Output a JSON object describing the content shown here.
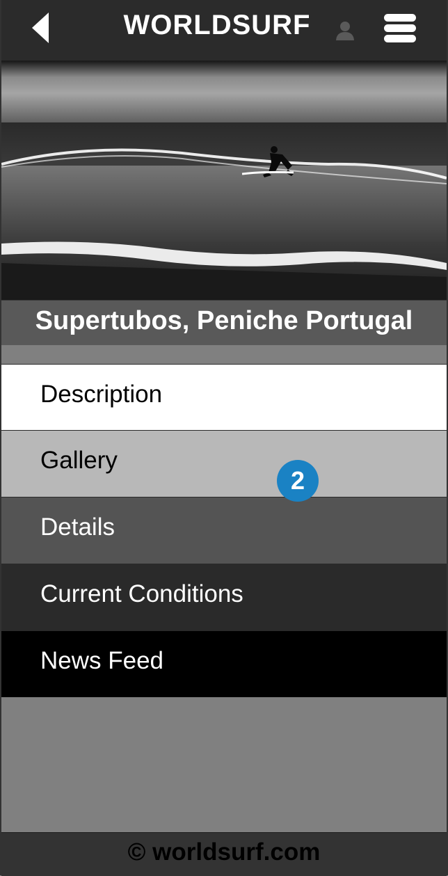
{
  "header": {
    "title": "WORLDSURF",
    "icons": {
      "back": "chevron-left-icon",
      "profile": "user-icon",
      "menu": "hamburger-menu-icon"
    }
  },
  "hero": {
    "image": "black-and-white photo of a surfer riding a wave"
  },
  "location": {
    "name": "Supertubos, Peniche Portugal"
  },
  "nav": {
    "items": [
      {
        "label": "Description"
      },
      {
        "label": "Gallery"
      },
      {
        "label": "Details"
      },
      {
        "label": "Current Conditions"
      },
      {
        "label": "News Feed"
      }
    ]
  },
  "badge": {
    "value": "2",
    "color": "#1a82c4"
  },
  "footer": {
    "text": "© worldsurf.com"
  }
}
